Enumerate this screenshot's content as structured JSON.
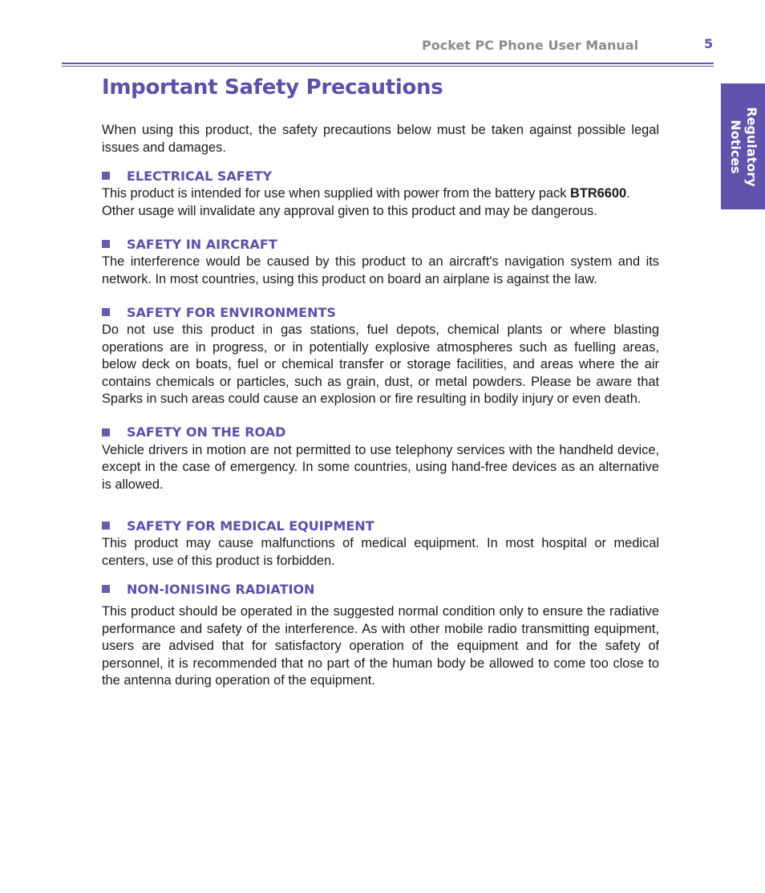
{
  "header": {
    "manual_title": "Pocket PC Phone User Manual",
    "page_number": "5"
  },
  "side_tab": {
    "label": "Regulatory\nNotices"
  },
  "page_title": "Important Safety Precautions",
  "intro": "When using this product, the safety precautions below must be taken against possible legal issues and damages.",
  "sections": [
    {
      "heading": "ELECTRICAL SAFETY",
      "body_pre": "This product is intended for use when supplied with power from the battery pack ",
      "body_bold": "BTR6600",
      "body_post": ". Other usage will invalidate any approval given to this product and may be dangerous."
    },
    {
      "heading": "SAFETY IN AIRCRAFT",
      "body": "The interference would be caused by this product to an aircraft's navigation system and its network.  In most countries, using this product on board an airplane is against the law."
    },
    {
      "heading": "SAFETY FOR ENVIRONMENTS",
      "body": "Do not use this product in gas stations, fuel depots, chemical plants or where blasting operations are in progress, or in potentially explosive atmospheres such as fuelling areas, below deck on boats, fuel or chemical transfer or storage facilities, and areas where the air contains chemicals or particles, such as grain, dust, or metal powders. Please be aware that Sparks in such areas could cause an explosion or fire resulting in bodily injury or even death."
    },
    {
      "heading": "SAFETY ON THE ROAD",
      "body": "Vehicle drivers in motion are not permitted to use telephony services with the handheld device, except in the case of emergency. In some countries, using hand-free devices as an alternative is allowed."
    },
    {
      "heading": "SAFETY FOR MEDICAL EQUIPMENT",
      "body": "This product may cause malfunctions of medical equipment. In most hospital or medical centers, use of this product is forbidden."
    },
    {
      "heading": "NON-IONISING RADIATION",
      "body": "This product should be operated in the suggested normal condition only to ensure the radiative performance and safety of the interference. As with other mobile radio transmitting equipment, users are advised that for satisfactory operation of the equipment and for the safety of personnel, it is recommended that no part of the human body be allowed to come too close to the antenna during operation of the equipment."
    }
  ]
}
